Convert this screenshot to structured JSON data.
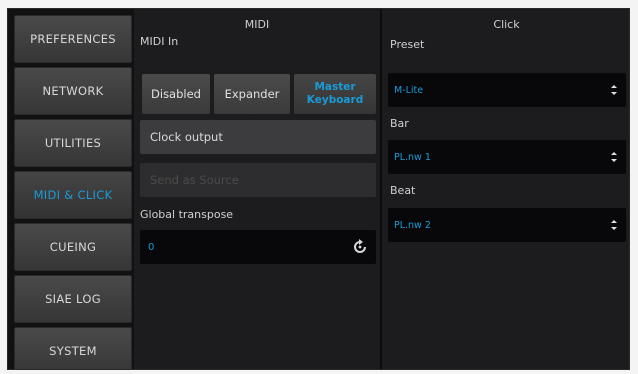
{
  "sidebar": {
    "items": [
      {
        "label": "PREFERENCES",
        "active": false
      },
      {
        "label": "NETWORK",
        "active": false
      },
      {
        "label": "UTILITIES",
        "active": false
      },
      {
        "label": "MIDI & CLICK",
        "active": true
      },
      {
        "label": "CUEING",
        "active": false
      },
      {
        "label": "SIAE LOG",
        "active": false
      },
      {
        "label": "SYSTEM",
        "active": false
      }
    ]
  },
  "midi": {
    "title": "MIDI",
    "midi_in_label": "MIDI In",
    "modes": [
      {
        "label": "Disabled",
        "active": false
      },
      {
        "label": "Expander",
        "active": false
      },
      {
        "label": "Master\nKeyboard",
        "active": true
      }
    ],
    "clock_output_label": "Clock output",
    "disabled_field_label": "Send as Source",
    "global_transpose_label": "Global transpose",
    "global_transpose_value": "0"
  },
  "click": {
    "title": "Click",
    "preset_label": "Preset",
    "preset_value": "M-Lite",
    "bar_label": "Bar",
    "bar_value": "PL.nw 1",
    "beat_label": "Beat",
    "beat_value": "PL.nw 2"
  },
  "colors": {
    "accent": "#1a9bd7",
    "panel_bg": "#1c1c1e",
    "button_bg": "#3c3c3e"
  }
}
